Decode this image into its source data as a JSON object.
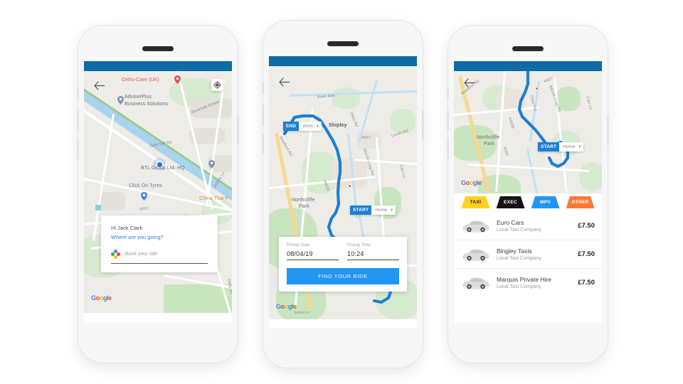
{
  "app": {
    "accent_blue": "#0d6ba5",
    "button_blue": "#2196F3",
    "back_icon": "←"
  },
  "phone1": {
    "name": "booking-start-screen",
    "back_icon": "back-arrow-icon",
    "locate_icon": "my-location-icon",
    "card": {
      "greeting": "Hi Jack Clark",
      "question": "Where are you going?",
      "input_placeholder": "Book your ride",
      "input_value": ""
    },
    "map_labels": [
      "Ortho-Care (UK)",
      "AdviserPlus",
      "Business Solutions",
      "Riverside Estate",
      "Salts Mill Rd",
      "BTL Group Ltd. HQ",
      "Click On Tyres",
      "China Thai F",
      "Ashley Ln",
      "A657",
      "Otley Rd"
    ],
    "google_watermark": "Google"
  },
  "phone2": {
    "name": "route-and-pickup-screen",
    "back_icon": "back-arrow-icon",
    "end_pill": {
      "tag": "END",
      "label": "Work",
      "chevron": "›"
    },
    "start_pill": {
      "tag": "START",
      "label": "Home",
      "chevron": "›"
    },
    "map_labels": [
      "Shipley",
      "River Aire",
      "Leeds Rd",
      "Bradford Rd",
      "Northcliffe",
      "Park",
      "Otley Rd",
      "A657",
      "B6149 Crag Rd",
      "A6038",
      "Carr Ln",
      "Emm Ln"
    ],
    "form": {
      "date_label": "Pickup Date",
      "date_value": "08/04/19",
      "time_label": "Pickup Time",
      "time_value": "10:24",
      "submit_label": "FIND YOUR RIDE"
    },
    "google_watermark": "Google"
  },
  "phone3": {
    "name": "operator-results-screen",
    "back_icon": "back-arrow-icon",
    "start_pill": {
      "tag": "START",
      "label": "Home",
      "chevron": "›"
    },
    "map_labels": [
      "Bradford Rd",
      "Northcliffe",
      "Park",
      "A657",
      "B6149 Crag Rd",
      "A6038",
      "A650",
      "Otley Rd",
      "Carr Ln"
    ],
    "google_watermark": "Google",
    "tabs": [
      {
        "label": "TAXI",
        "color": "#FFD021",
        "text_color": "#1b1b1b",
        "active": true
      },
      {
        "label": "EXEC",
        "color": "#141414",
        "text_color": "#ffffff",
        "active": false
      },
      {
        "label": "MPV",
        "color": "#2196F3",
        "text_color": "#ffffff",
        "active": false
      },
      {
        "label": "OTHER",
        "color": "#F97935",
        "text_color": "#ffffff",
        "active": false
      }
    ],
    "operators": [
      {
        "name": "Euro Cars",
        "subtitle": "Local Taxi Company",
        "price": "£7.50"
      },
      {
        "name": "Bingley Taxis",
        "subtitle": "Local Taxi Company",
        "price": "£7.50"
      },
      {
        "name": "Marquis Private Hire",
        "subtitle": "Local Taxi Company",
        "price": "£7.50"
      }
    ]
  }
}
